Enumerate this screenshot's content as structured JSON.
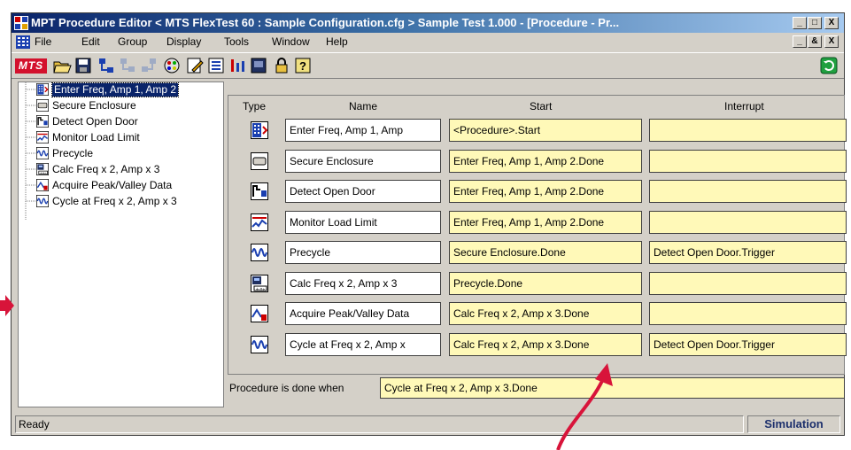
{
  "window": {
    "title": "MPT Procedure Editor  < MTS FlexTest 60 : Sample Configuration.cfg >  Sample Test 1.000 - [Procedure - Pr...",
    "controls": [
      "_",
      "□",
      "X"
    ],
    "doc_controls": [
      "_",
      "&",
      "X"
    ]
  },
  "menu": [
    "File",
    "Edit",
    "Group",
    "Display",
    "Tools",
    "Window",
    "Help"
  ],
  "toolbar": {
    "logo": "MTS",
    "icons": [
      "open-icon",
      "save-icon",
      "group-icon",
      "insert-before-icon",
      "insert-after-icon",
      "color-icon",
      "edit-icon",
      "properties-icon",
      "signal-icon",
      "station-icon",
      "lock-icon",
      "help-icon",
      "refresh-icon"
    ]
  },
  "tree": [
    {
      "label": "Enter Freq, Amp 1, Amp 2",
      "icon": "operator-entry-icon",
      "selected": true
    },
    {
      "label": "Secure Enclosure",
      "icon": "message-icon",
      "selected": false
    },
    {
      "label": "Detect Open Door",
      "icon": "digital-input-icon",
      "selected": false
    },
    {
      "label": "Monitor Load Limit",
      "icon": "limit-detector-icon",
      "selected": false
    },
    {
      "label": "Precycle",
      "icon": "cyclic-command-icon",
      "selected": false
    },
    {
      "label": "Calc Freq x 2, Amp  x 3",
      "icon": "calculator-icon",
      "selected": false
    },
    {
      "label": "Acquire Peak/Valley Data",
      "icon": "data-acquisition-icon",
      "selected": false
    },
    {
      "label": "Cycle at Freq x 2, Amp x 3",
      "icon": "cyclic-command-icon",
      "selected": false
    }
  ],
  "grid": {
    "headers": {
      "type": "Type",
      "name": "Name",
      "start": "Start",
      "interrupt": "Interrupt"
    },
    "rows": [
      {
        "icon": "operator-entry-icon",
        "name": "Enter Freq, Amp 1, Amp",
        "start": "<Procedure>.Start",
        "interrupt": ""
      },
      {
        "icon": "message-icon",
        "name": "Secure Enclosure",
        "start": "Enter Freq, Amp 1, Amp 2.Done",
        "interrupt": ""
      },
      {
        "icon": "digital-input-icon",
        "name": "Detect Open Door",
        "start": "Enter Freq, Amp 1, Amp 2.Done",
        "interrupt": ""
      },
      {
        "icon": "limit-detector-icon",
        "name": "Monitor Load Limit",
        "start": "Enter Freq, Amp 1, Amp 2.Done",
        "interrupt": ""
      },
      {
        "icon": "cyclic-command-icon",
        "name": "Precycle",
        "start": "Secure Enclosure.Done",
        "interrupt": "Detect Open Door.Trigger"
      },
      {
        "icon": "calculator-icon",
        "name": "Calc Freq x 2, Amp  x 3",
        "start": "Precycle.Done",
        "interrupt": ""
      },
      {
        "icon": "data-acquisition-icon",
        "name": "Acquire Peak/Valley Data",
        "start": "Calc Freq x 2, Amp  x 3.Done",
        "interrupt": ""
      },
      {
        "icon": "cyclic-command-icon",
        "name": "Cycle at Freq x 2, Amp x",
        "start": "Calc Freq x 2, Amp  x 3.Done",
        "interrupt": "Detect Open Door.Trigger"
      }
    ]
  },
  "done": {
    "label": "Procedure is done when",
    "value": "Cycle at Freq x 2, Amp x 3.Done"
  },
  "status": {
    "left": "Ready",
    "right": "Simulation"
  },
  "colors": {
    "accent_arrow": "#d8143a",
    "yellow_cell": "#fff9b8",
    "title_blue": "#0a246a"
  }
}
